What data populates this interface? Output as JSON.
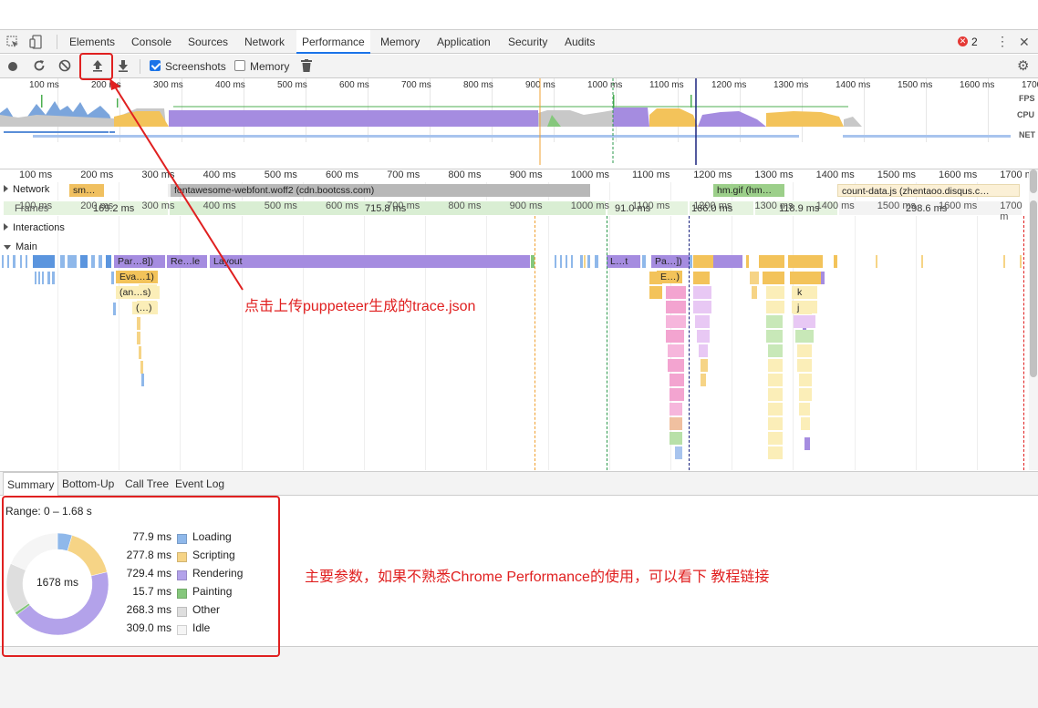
{
  "tabs": [
    "Elements",
    "Console",
    "Sources",
    "Network",
    "Performance",
    "Memory",
    "Application",
    "Security",
    "Audits"
  ],
  "active_tab": "Performance",
  "error_count": "2",
  "toolbar": {
    "screenshots_label": "Screenshots",
    "screenshots_checked": true,
    "memory_label": "Memory",
    "memory_checked": false
  },
  "overview": {
    "ticks": [
      "100 ms",
      "200 ms",
      "300 ms",
      "400 ms",
      "500 ms",
      "600 ms",
      "700 ms",
      "800 ms",
      "900 ms",
      "1000 ms",
      "1100 ms",
      "1200 ms",
      "1300 ms",
      "1400 ms",
      "1500 ms",
      "1600 ms",
      "1700"
    ],
    "fps_label": "FPS",
    "cpu_label": "CPU",
    "net_label": "NET"
  },
  "ruler": {
    "ticks": [
      "100 ms",
      "200 ms",
      "300 ms",
      "400 ms",
      "500 ms",
      "600 ms",
      "700 ms",
      "800 ms",
      "900 ms",
      "1000 ms",
      "1100 ms",
      "1200 ms",
      "1300 ms",
      "1400 ms",
      "1500 ms",
      "1600 ms",
      "1700 m"
    ]
  },
  "tracks": {
    "network_label": "Network",
    "network_items": [
      "sm…",
      "fontawesome-webfont.woff2 (cdn.bootcss.com)",
      "hm.gif (hm…",
      "count-data.js (zhentaoo.disqus.c…"
    ],
    "frames_label": "Frames",
    "frame_times": [
      "169.2 ms",
      "715.8 ms",
      "91.0 ms",
      "166.0 ms",
      "118.9 ms",
      "298.6 ms"
    ],
    "interactions_label": "Interactions",
    "main_label": "Main",
    "main_bars": [
      "Par…8])",
      "Re…le",
      "Layout",
      "L…t",
      "Pa…])",
      "Eva…1)",
      "E…)",
      "(an…s)",
      "(…)",
      "k",
      "j"
    ]
  },
  "bottom_tabs": [
    "Summary",
    "Bottom-Up",
    "Call Tree",
    "Event Log"
  ],
  "summary": {
    "range": "Range: 0 – 1.68 s",
    "total": "1678 ms",
    "items": [
      {
        "value": "77.9 ms",
        "name": "Loading",
        "color": "#8fb8ea",
        "ms": 77.9
      },
      {
        "value": "277.8 ms",
        "name": "Scripting",
        "color": "#f6d486",
        "ms": 277.8
      },
      {
        "value": "729.4 ms",
        "name": "Rendering",
        "color": "#b3a2ea",
        "ms": 729.4
      },
      {
        "value": "15.7 ms",
        "name": "Painting",
        "color": "#85c77c",
        "ms": 15.7
      },
      {
        "value": "268.3 ms",
        "name": "Other",
        "color": "#dedede",
        "ms": 268.3
      },
      {
        "value": "309.0 ms",
        "name": "Idle",
        "color": "#f5f5f5",
        "ms": 309.0
      }
    ]
  },
  "annotations": {
    "upload_note": "点击上传puppeteer生成的trace.json",
    "params_note": "主要参数，如果不熟悉Chrome Performance的使用，可以看下 教程链接"
  }
}
